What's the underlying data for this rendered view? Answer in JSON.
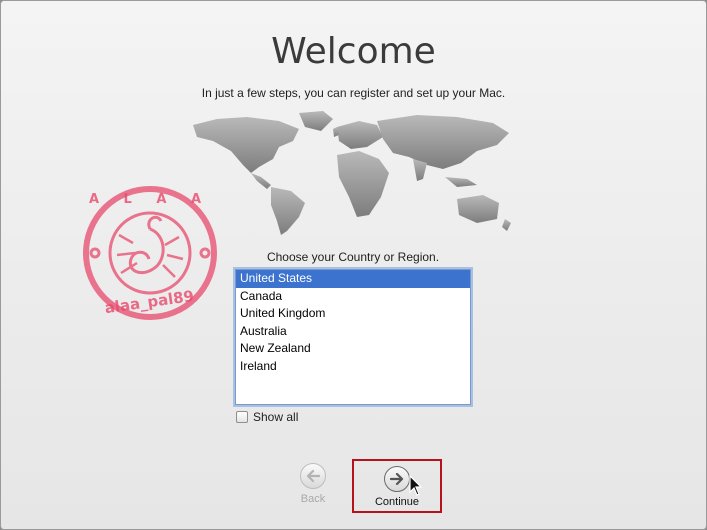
{
  "header": {
    "title": "Welcome",
    "subtitle": "In just a few steps, you can register and set up your Mac."
  },
  "region_prompt": "Choose your Country or Region.",
  "countries": {
    "selected_index": 0,
    "items": [
      "United States",
      "Canada",
      "United Kingdom",
      "Australia",
      "New Zealand",
      "Ireland"
    ]
  },
  "show_all": {
    "label": "Show all",
    "checked": false
  },
  "nav": {
    "back_label": "Back",
    "continue_label": "Continue",
    "back_icon": "left-arrow-circle-icon",
    "continue_icon": "right-arrow-circle-icon"
  },
  "stamp": {
    "top_text": "A L A A",
    "bottom_text": "alaa_pal89"
  },
  "colors": {
    "selection": "#3c73cf",
    "highlight_box": "#b5121b",
    "stamp": "#e84a6c"
  }
}
